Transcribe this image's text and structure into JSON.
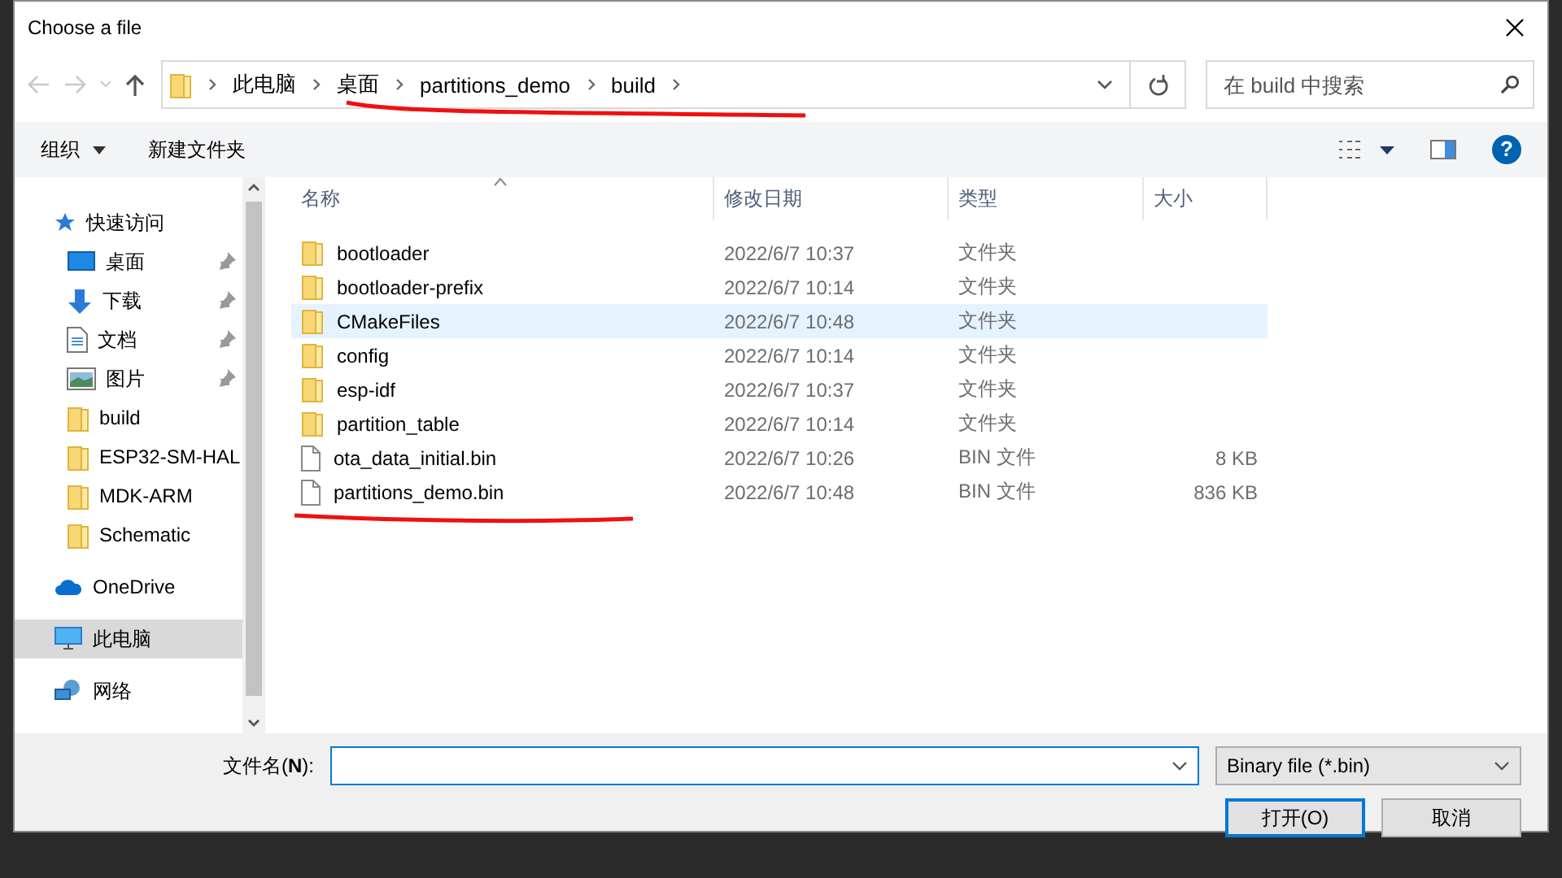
{
  "window": {
    "title": "Choose a file"
  },
  "address": {
    "crumbs": [
      "此电脑",
      "桌面",
      "partitions_demo",
      "build"
    ]
  },
  "search": {
    "placeholder": "在 build 中搜索"
  },
  "toolbar": {
    "organize": "组织",
    "new_folder": "新建文件夹",
    "help": "?"
  },
  "sidebar": {
    "items": [
      {
        "label": "快速访问",
        "kind": "star",
        "pinned": false,
        "selected": false,
        "group": true
      },
      {
        "label": "桌面",
        "kind": "desktop",
        "pinned": true,
        "selected": false,
        "group": false
      },
      {
        "label": "下载",
        "kind": "download",
        "pinned": true,
        "selected": false,
        "group": false
      },
      {
        "label": "文档",
        "kind": "document",
        "pinned": true,
        "selected": false,
        "group": false
      },
      {
        "label": "图片",
        "kind": "picture",
        "pinned": true,
        "selected": false,
        "group": false
      },
      {
        "label": "build",
        "kind": "folder",
        "pinned": false,
        "selected": false,
        "group": false
      },
      {
        "label": "ESP32-SM-HAL",
        "kind": "folder",
        "pinned": false,
        "selected": false,
        "group": false
      },
      {
        "label": "MDK-ARM",
        "kind": "folder",
        "pinned": false,
        "selected": false,
        "group": false
      },
      {
        "label": "Schematic",
        "kind": "folder",
        "pinned": false,
        "selected": false,
        "group": false
      },
      {
        "label": "OneDrive",
        "kind": "cloud",
        "pinned": false,
        "selected": false,
        "group": true
      },
      {
        "label": "此电脑",
        "kind": "pc",
        "pinned": false,
        "selected": true,
        "group": true
      },
      {
        "label": "网络",
        "kind": "network",
        "pinned": false,
        "selected": false,
        "group": true
      }
    ]
  },
  "table": {
    "columns": [
      "名称",
      "修改日期",
      "类型",
      "大小"
    ],
    "rows": [
      {
        "name": "bootloader",
        "date": "2022/6/7 10:37",
        "type": "文件夹",
        "size": "",
        "kind": "folder",
        "highlighted": false
      },
      {
        "name": "bootloader-prefix",
        "date": "2022/6/7 10:14",
        "type": "文件夹",
        "size": "",
        "kind": "folder",
        "highlighted": false
      },
      {
        "name": "CMakeFiles",
        "date": "2022/6/7 10:48",
        "type": "文件夹",
        "size": "",
        "kind": "folder",
        "highlighted": true
      },
      {
        "name": "config",
        "date": "2022/6/7 10:14",
        "type": "文件夹",
        "size": "",
        "kind": "folder",
        "highlighted": false
      },
      {
        "name": "esp-idf",
        "date": "2022/6/7 10:37",
        "type": "文件夹",
        "size": "",
        "kind": "folder",
        "highlighted": false
      },
      {
        "name": "partition_table",
        "date": "2022/6/7 10:14",
        "type": "文件夹",
        "size": "",
        "kind": "folder",
        "highlighted": false
      },
      {
        "name": "ota_data_initial.bin",
        "date": "2022/6/7 10:26",
        "type": "BIN 文件",
        "size": "8 KB",
        "kind": "file",
        "highlighted": false
      },
      {
        "name": "partitions_demo.bin",
        "date": "2022/6/7 10:48",
        "type": "BIN 文件",
        "size": "836 KB",
        "kind": "file",
        "highlighted": false
      }
    ]
  },
  "footer": {
    "filename_label": "文件名(**N**):",
    "filter": "Binary file (*.bin)",
    "open": "打开(O)",
    "cancel": "取消"
  }
}
